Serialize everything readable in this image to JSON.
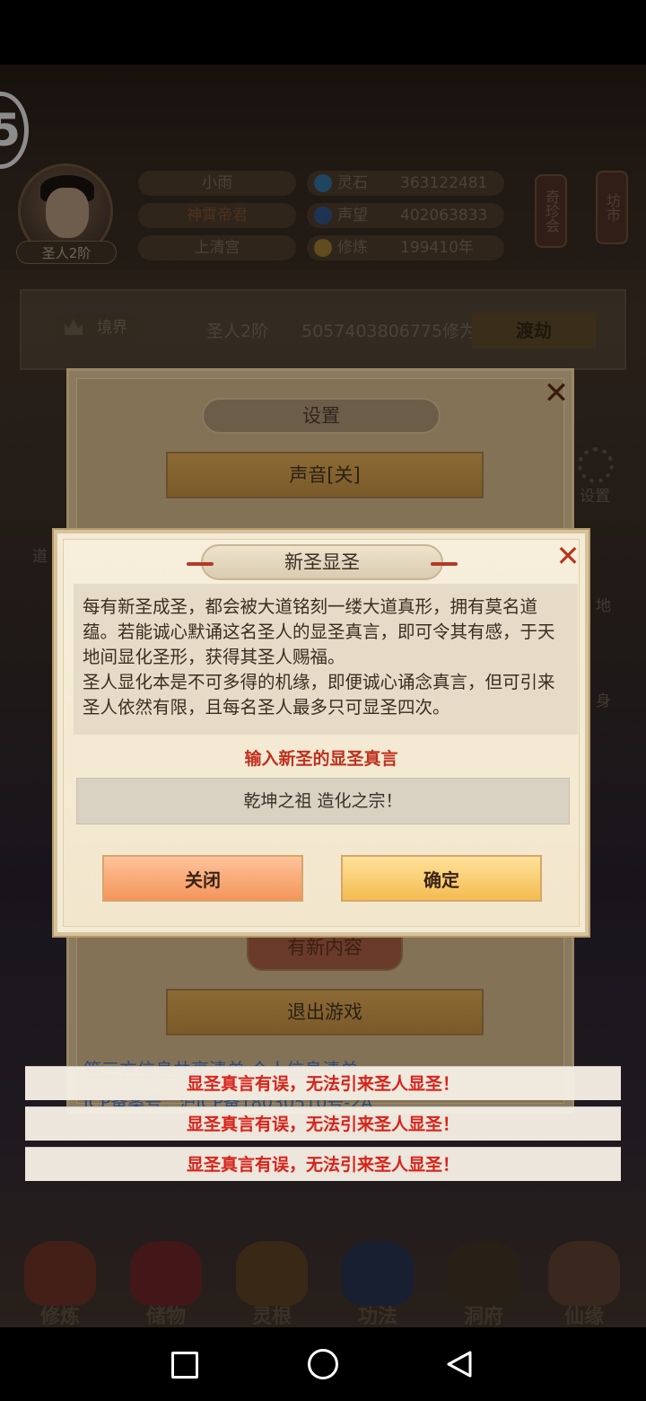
{
  "hud": {
    "name": "小雨",
    "title": "神霄帝君",
    "sect": "上清宫",
    "rank_tag": "圣人2阶",
    "stats": [
      {
        "label": "灵石",
        "value": "363122481",
        "icon_color": "#3b7fb0"
      },
      {
        "label": "声望",
        "value": "402063833",
        "icon_color": "#3a5f9a"
      },
      {
        "label": "修炼",
        "value": "199410年",
        "icon_color": "#b08a3a"
      }
    ],
    "lanterns": [
      "奇珍会",
      "坊市"
    ]
  },
  "realm": {
    "label": "境界",
    "rank": "圣人2阶",
    "cultivation": "5057403806775修为",
    "button": "渡劫"
  },
  "side": {
    "settings_label": "设置",
    "dao_label": "道",
    "land_label": "地",
    "body_label": "身"
  },
  "settings_dialog": {
    "title": "设置",
    "sound_button": "声音[关]",
    "new_content_button": "有新内容",
    "quit_button": "退出游戏",
    "links": "第三方信息共享清单   个人信息清单",
    "icp": "ICP备案号：沪ICP备18030510号-2A"
  },
  "dialog": {
    "title": "新圣显圣",
    "description": [
      "每有新圣成圣，都会被大道铭刻一缕大道真形，拥有莫名道蕴。若能诚心默诵这名圣人的显圣真言，即可令其有感，于天地间显化圣形，获得其圣人赐福。",
      "圣人显化本是不可多得的机缘，即便诚心诵念真言，但可引来圣人依然有限，且每名圣人最多只可显圣四次。"
    ],
    "input_label": "输入新圣的显圣真言",
    "input_value": "乾坤之祖    造化之宗！",
    "close_button": "关闭",
    "confirm_button": "确定"
  },
  "toasts": [
    "显圣真言有误，无法引来圣人显圣！",
    "显圣真言有误，无法引来圣人显圣！",
    "显圣真言有误，无法引来圣人显圣！"
  ],
  "bottom_nav": [
    {
      "label": "修炼",
      "color": "#7a3a2a"
    },
    {
      "label": "储物",
      "color": "#7a2a2a"
    },
    {
      "label": "灵根",
      "color": "#6a4a2a"
    },
    {
      "label": "功法",
      "color": "#2a3a5a"
    },
    {
      "label": "洞府",
      "color": "#4a3a2a"
    },
    {
      "label": "仙缘",
      "color": "#6a4a3a"
    }
  ],
  "colors": {
    "accent_red": "#c0301e",
    "toast_red": "#d8231a",
    "close_button": "#f3955c",
    "confirm_button": "#f4bb52"
  }
}
